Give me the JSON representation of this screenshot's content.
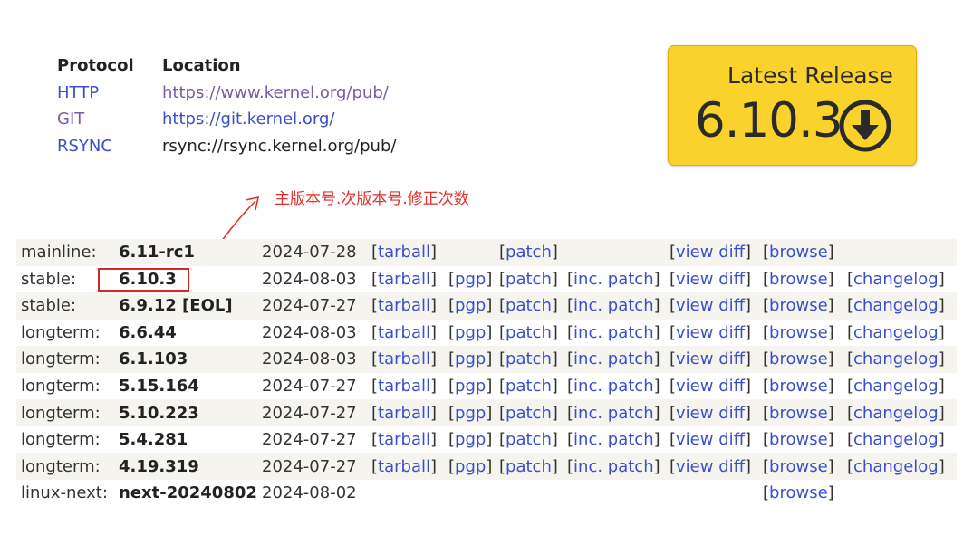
{
  "protocols": {
    "header_protocol": "Protocol",
    "header_location": "Location",
    "rows": [
      {
        "name": "HTTP",
        "location": "https://www.kernel.org/pub/"
      },
      {
        "name": "GIT",
        "location": "https://git.kernel.org/"
      },
      {
        "name": "RSYNC",
        "location": "rsync://rsync.kernel.org/pub/"
      }
    ]
  },
  "latest_release": {
    "title": "Latest Release",
    "version": "6.10.3",
    "icon": "download-circle-icon",
    "color": "#f9d22b"
  },
  "annotation": {
    "text": "主版本号.次版本号.修正次数",
    "color": "#e0302a"
  },
  "links": {
    "tarball": "tarball",
    "pgp": "pgp",
    "patch": "patch",
    "inc_patch": "inc. patch",
    "view_diff": "view diff",
    "browse": "browse",
    "changelog": "changelog"
  },
  "releases": [
    {
      "kind": "mainline:",
      "version": "6.11-rc1",
      "date": "2024-07-28"
    },
    {
      "kind": "stable:",
      "version": "6.10.3",
      "date": "2024-08-03"
    },
    {
      "kind": "stable:",
      "version": "6.9.12 [EOL]",
      "date": "2024-07-27"
    },
    {
      "kind": "longterm:",
      "version": "6.6.44",
      "date": "2024-08-03"
    },
    {
      "kind": "longterm:",
      "version": "6.1.103",
      "date": "2024-08-03"
    },
    {
      "kind": "longterm:",
      "version": "5.15.164",
      "date": "2024-07-27"
    },
    {
      "kind": "longterm:",
      "version": "5.10.223",
      "date": "2024-07-27"
    },
    {
      "kind": "longterm:",
      "version": "5.4.281",
      "date": "2024-07-27"
    },
    {
      "kind": "longterm:",
      "version": "4.19.319",
      "date": "2024-07-27"
    },
    {
      "kind": "linux-next:",
      "version": "next-20240802",
      "date": "2024-08-02"
    }
  ]
}
